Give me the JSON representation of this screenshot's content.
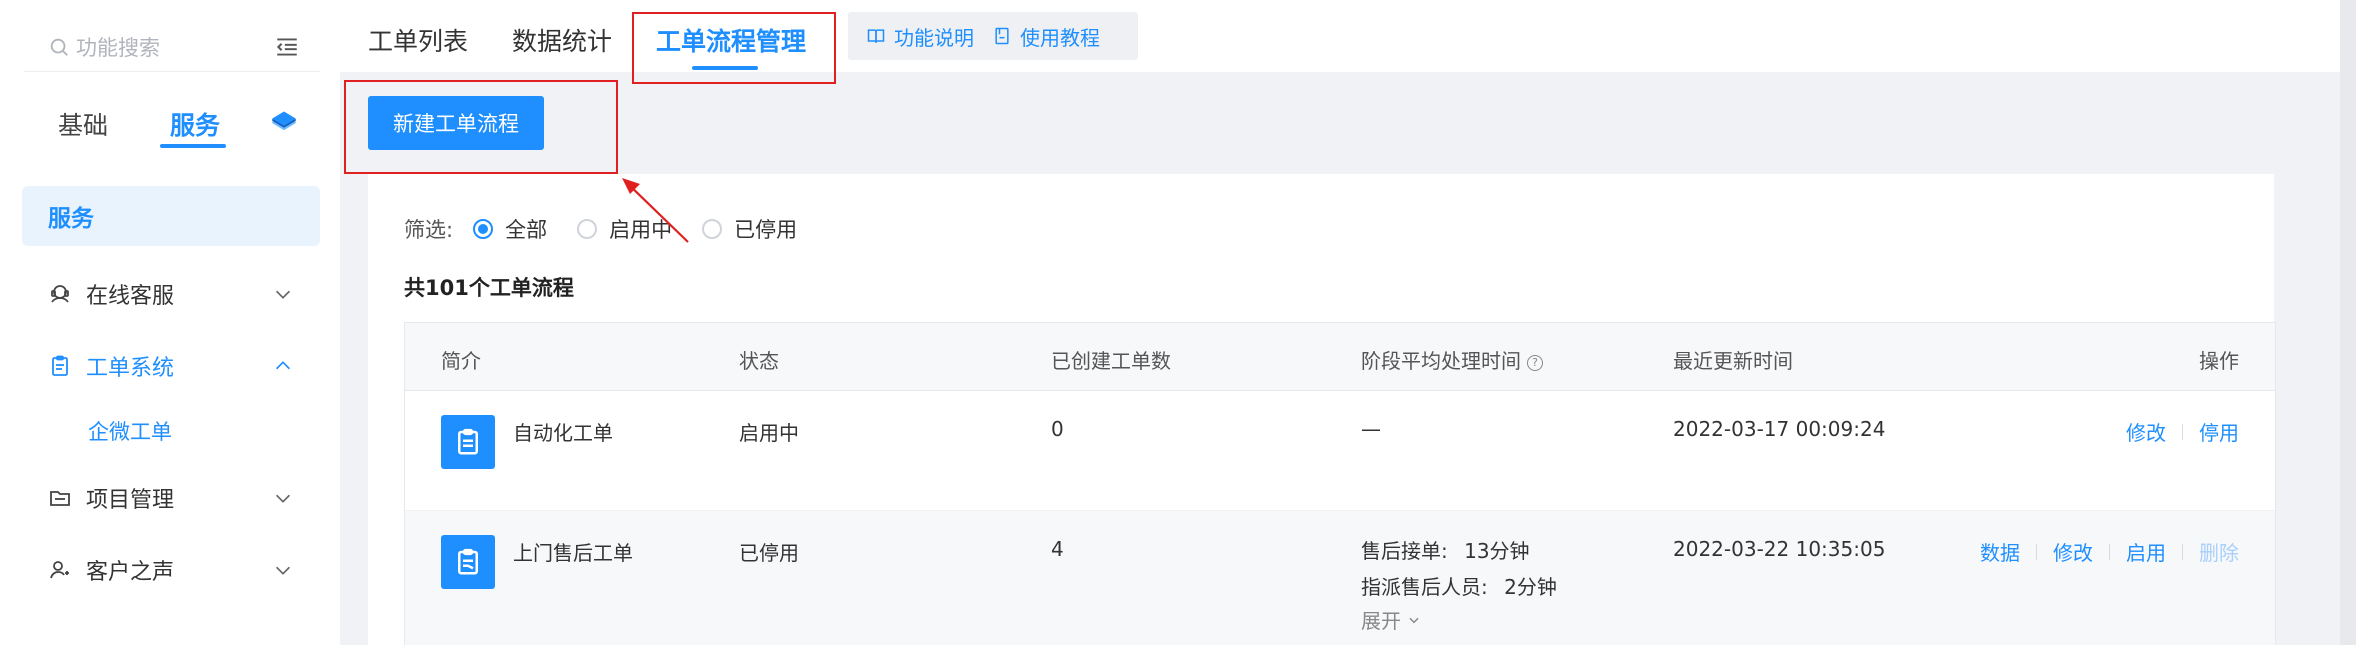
{
  "sidebar": {
    "search_placeholder": "功能搜索",
    "top_tabs": {
      "basic": "基础",
      "service": "服务"
    },
    "section_title": "服务",
    "items": [
      {
        "label": "在线客服"
      },
      {
        "label": "工单系统"
      },
      {
        "label": "项目管理"
      },
      {
        "label": "客户之声"
      }
    ],
    "sub_item": "企微工单"
  },
  "topbar": {
    "tabs": [
      {
        "label": "工单列表"
      },
      {
        "label": "数据统计"
      },
      {
        "label": "工单流程管理"
      }
    ],
    "help_links": [
      {
        "label": "功能说明"
      },
      {
        "label": "使用教程"
      }
    ]
  },
  "main": {
    "new_button": "新建工单流程",
    "filter": {
      "label": "筛选:",
      "options": [
        {
          "label": "全部"
        },
        {
          "label": "启用中"
        },
        {
          "label": "已停用"
        }
      ]
    },
    "count_text": "共101个工单流程",
    "table": {
      "headers": [
        "简介",
        "状态",
        "已创建工单数",
        "阶段平均处理时间",
        "最近更新时间",
        "操作"
      ],
      "rows": [
        {
          "name": "自动化工单",
          "status": "启用中",
          "created": "0",
          "avg_time": "—",
          "updated": "2022-03-17 00:09:24",
          "ops": [
            "修改",
            "停用"
          ]
        },
        {
          "name": "上门售后工单",
          "status": "已停用",
          "created": "4",
          "stages": [
            {
              "label": "售后接单:",
              "value": "13分钟"
            },
            {
              "label": "指派售后人员:",
              "value": "2分钟"
            }
          ],
          "expand": "展开",
          "updated": "2022-03-22 10:35:05",
          "ops": [
            "数据",
            "修改",
            "启用",
            "删除"
          ]
        }
      ]
    }
  },
  "colors": {
    "accent": "#1f8fff",
    "annotation": "#e02020"
  }
}
